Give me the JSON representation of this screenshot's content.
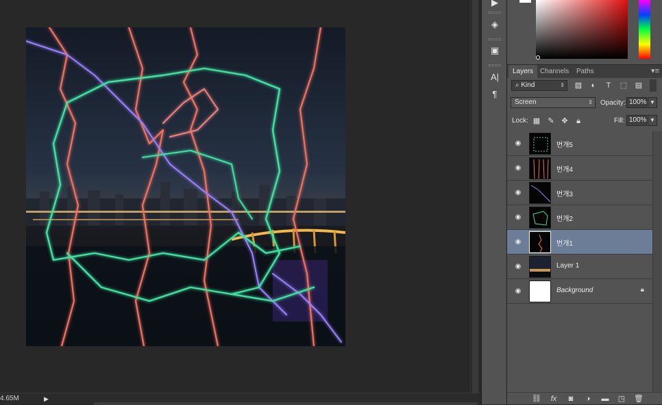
{
  "status": {
    "doc_size": "4.65M"
  },
  "colors": {
    "selection": "#6c7d97",
    "panel_bg": "#535353",
    "workspace_bg": "#282828"
  },
  "dock": {
    "icons": [
      "play-icon",
      "cube-3d-icon",
      "swatch-history-icon",
      "character-icon",
      "paragraph-icon"
    ],
    "character_glyph": "A|",
    "paragraph_glyph": "¶"
  },
  "panel": {
    "tabs": [
      "Layers",
      "Channels",
      "Paths"
    ],
    "active_tab": "Layers",
    "filter": {
      "kind_label": "Kind"
    },
    "blend_mode": "Screen",
    "opacity_label": "Opacity:",
    "opacity_value": "100%",
    "lock_label": "Lock:",
    "fill_label": "Fill:",
    "fill_value": "100%",
    "layers": [
      {
        "name": "번개5",
        "visible": true,
        "selected": false,
        "locked": false
      },
      {
        "name": "번개4",
        "visible": true,
        "selected": false,
        "locked": false
      },
      {
        "name": "번개3",
        "visible": true,
        "selected": false,
        "locked": false
      },
      {
        "name": "번개2",
        "visible": true,
        "selected": false,
        "locked": false
      },
      {
        "name": "번개1",
        "visible": true,
        "selected": true,
        "locked": false
      },
      {
        "name": "Layer 1",
        "visible": true,
        "selected": false,
        "locked": false
      },
      {
        "name": "Background",
        "visible": true,
        "selected": false,
        "locked": true
      }
    ],
    "bottom_icons": [
      "link-icon",
      "fx-icon",
      "mask-icon",
      "adjustment-icon",
      "group-folder-icon",
      "new-layer-icon",
      "trash-icon"
    ]
  }
}
